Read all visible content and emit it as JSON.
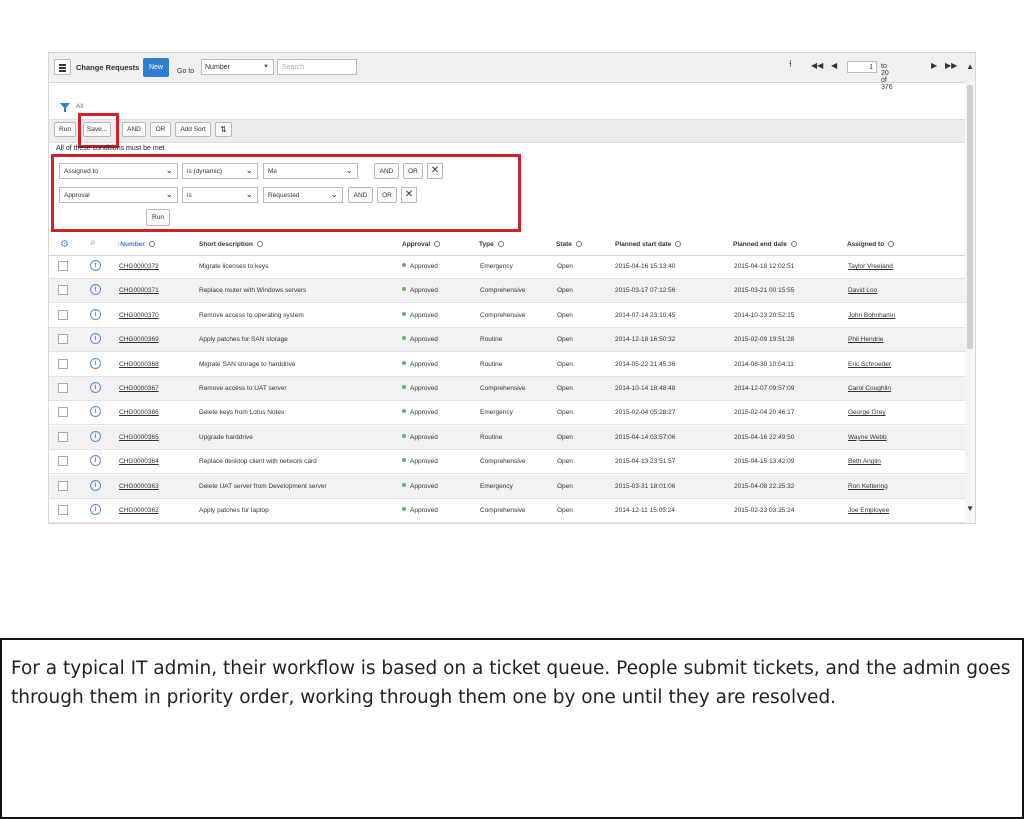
{
  "header": {
    "title": "Change Requests",
    "new_label": "New",
    "goto_label": "Go to",
    "field_select": "Number",
    "search_placeholder": "Search",
    "page_value": "1",
    "page_range": "to 20 of 376"
  },
  "filter": {
    "breadcrumb": "All",
    "toolbar": {
      "run": "Run",
      "save": "Save...",
      "and": "AND",
      "or": "OR",
      "add_sort": "Add Sort"
    },
    "heading": "All of these conditions must be met",
    "conditions": [
      {
        "field": "Assigned to",
        "operator": "is (dynamic)",
        "value": "Me"
      },
      {
        "field": "Approval",
        "operator": "is",
        "value": "Requested"
      }
    ],
    "and_label": "AND",
    "or_label": "OR",
    "run_label": "Run"
  },
  "table": {
    "columns": [
      "Number",
      "Short description",
      "Approval",
      "Type",
      "State",
      "Planned start date",
      "Planned end date",
      "Assigned to"
    ],
    "rows": [
      {
        "number": "CHG0000372",
        "desc": "Migrate licenses to keys",
        "approval": "Approved",
        "type": "Emergency",
        "state": "Open",
        "start": "2015-04-16 15:13:40",
        "end": "2015-04-18 12:02:51",
        "assigned": "Taylor Vreeland"
      },
      {
        "number": "CHG0000371",
        "desc": "Replace router with Windows servers",
        "approval": "Approved",
        "type": "Comprehensive",
        "state": "Open",
        "start": "2015-03-17 07:12:56",
        "end": "2015-03-21 00:15:55",
        "assigned": "David Loo"
      },
      {
        "number": "CHG0000370",
        "desc": "Remove access to operating system",
        "approval": "Approved",
        "type": "Comprehensive",
        "state": "Open",
        "start": "2014-07-14 23:10:45",
        "end": "2014-10-23 20:52:15",
        "assigned": "John Bohnhamn"
      },
      {
        "number": "CHG0000369",
        "desc": "Apply patches for SAN storage",
        "approval": "Approved",
        "type": "Routine",
        "state": "Open",
        "start": "2014-12-18 16:50:32",
        "end": "2015-02-09 19:51:28",
        "assigned": "Phil Hendrie"
      },
      {
        "number": "CHG0000368",
        "desc": "Migrate SAN storage to harddrive",
        "approval": "Approved",
        "type": "Routine",
        "state": "Open",
        "start": "2014-05-22 21:45:36",
        "end": "2014-08-30 10:04:11",
        "assigned": "Eric Schroeder"
      },
      {
        "number": "CHG0000367",
        "desc": "Remove access to UAT server",
        "approval": "Approved",
        "type": "Comprehensive",
        "state": "Open",
        "start": "2014-10-14 18:48:48",
        "end": "2014-12-07 09:57:09",
        "assigned": "Carol Coughlin"
      },
      {
        "number": "CHG0000366",
        "desc": "Delete keys from Lotus Notes",
        "approval": "Approved",
        "type": "Emergency",
        "state": "Open",
        "start": "2015-02-04 05:28:27",
        "end": "2015-02-04 20:46:17",
        "assigned": "George Grey"
      },
      {
        "number": "CHG0000365",
        "desc": "Upgrade harddrive",
        "approval": "Approved",
        "type": "Routine",
        "state": "Open",
        "start": "2015-04-14 03:57:06",
        "end": "2015-04-16 22:49:50",
        "assigned": "Wayne Webb"
      },
      {
        "number": "CHG0000364",
        "desc": "Replace desktop client with network card",
        "approval": "Approved",
        "type": "Comprehensive",
        "state": "Open",
        "start": "2015-04-13 23:51:57",
        "end": "2015-04-15 13:42:09",
        "assigned": "Beth Anglin"
      },
      {
        "number": "CHG0000363",
        "desc": "Delete UAT server from Development server",
        "approval": "Approved",
        "type": "Emergency",
        "state": "Open",
        "start": "2015-03-31 18:01:06",
        "end": "2015-04-08 22:25:32",
        "assigned": "Ron Kettering"
      },
      {
        "number": "CHG0000362",
        "desc": "Apply patches for laptop",
        "approval": "Approved",
        "type": "Comprehensive",
        "state": "Open",
        "start": "2014-12-11 15:05:24",
        "end": "2015-02-23 03:25:24",
        "assigned": "Joe Employee"
      }
    ]
  },
  "colors": {
    "accent": "#2f7fd1",
    "highlight": "#d0202a",
    "approved_dot": "#5cb85c"
  },
  "caption": "For a typical IT admin, their workflow is based on a ticket queue. People submit tickets, and the admin goes through them in priority order, working through them one by one until they are resolved."
}
